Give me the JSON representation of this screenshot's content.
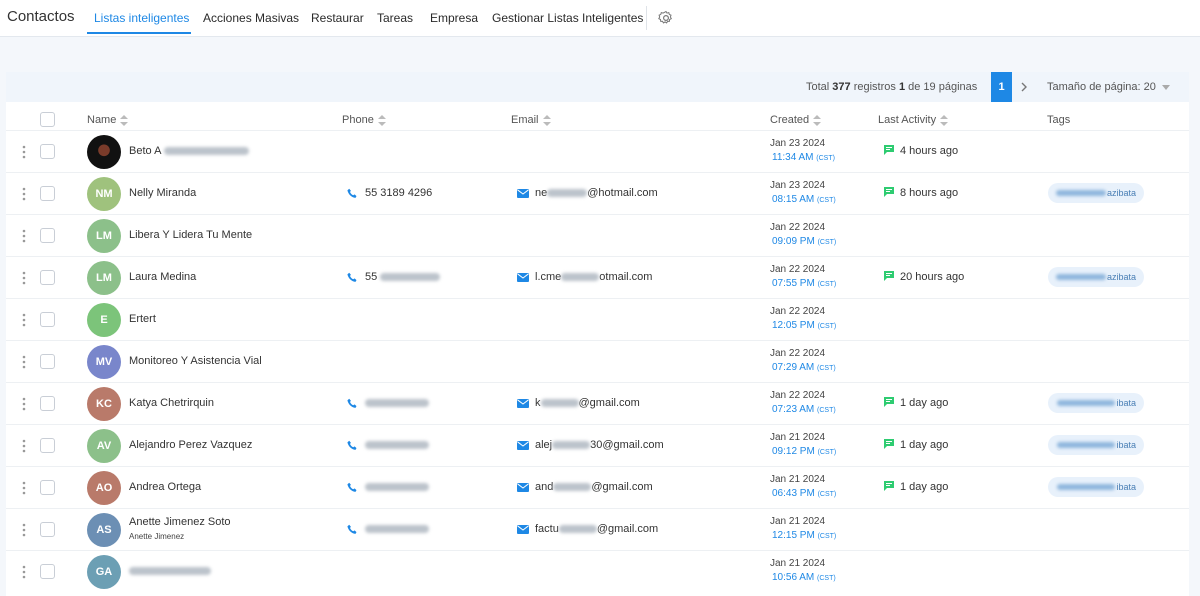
{
  "nav": {
    "brand": "Contactos",
    "tabs": [
      {
        "label": "Listas inteligentes"
      },
      {
        "label": "Acciones Masivas"
      },
      {
        "label": "Restaurar"
      },
      {
        "label": "Tareas"
      },
      {
        "label": "Empresa"
      },
      {
        "label": "Gestionar Listas Inteligentes"
      }
    ],
    "active_tab": "Listas inteligentes",
    "settings_icon": "gear-icon"
  },
  "pager": {
    "prefix": "Total ",
    "total": "377",
    "middle": " registros ",
    "current": "1",
    "suffix": " de 19 páginas",
    "page_button": "1",
    "page_size_label": "Tamaño de página: 20"
  },
  "table": {
    "headers": {
      "name": "Name",
      "phone": "Phone",
      "email": "Email",
      "created": "Created",
      "last_activity": "Last Activity",
      "tags": "Tags"
    },
    "rows": [
      {
        "initials": "",
        "name": "Beto A",
        "subname": "",
        "phone": "",
        "email": "",
        "created_date": "Jan 23 2024",
        "created_time": "11:34 AM",
        "tz": "(CST)",
        "activity": "4 hours ago",
        "tag": ""
      },
      {
        "initials": "NM",
        "name": "Nelly Miranda",
        "subname": "",
        "phone": "55 3189 4296",
        "email": "ne@hotmail.com",
        "created_date": "Jan 23 2024",
        "created_time": "08:15 AM",
        "tz": "(CST)",
        "activity": "8 hours ago",
        "tag": "azibata"
      },
      {
        "initials": "LM",
        "name": "Libera Y Lidera Tu Mente",
        "subname": "",
        "phone": "",
        "email": "",
        "created_date": "Jan 22 2024",
        "created_time": "09:09 PM",
        "tz": "(CST)",
        "activity": "",
        "tag": ""
      },
      {
        "initials": "LM",
        "name": "Laura Medina",
        "subname": "",
        "phone": "55",
        "email": "l.cme otmail.com",
        "created_date": "Jan 22 2024",
        "created_time": "07:55 PM",
        "tz": "(CST)",
        "activity": "20 hours ago",
        "tag": "azibata"
      },
      {
        "initials": "E",
        "name": "Ertert",
        "subname": "",
        "phone": "",
        "email": "",
        "created_date": "Jan 22 2024",
        "created_time": "12:05 PM",
        "tz": "(CST)",
        "activity": "",
        "tag": ""
      },
      {
        "initials": "MV",
        "name": "Monitoreo Y Asistencia Vial",
        "subname": "",
        "phone": "",
        "email": "",
        "created_date": "Jan 22 2024",
        "created_time": "07:29 AM",
        "tz": "(CST)",
        "activity": "",
        "tag": ""
      },
      {
        "initials": "KC",
        "name": "Katya Chetrirquin",
        "subname": "",
        "phone": "",
        "email": "k @gmail.com",
        "created_date": "Jan 22 2024",
        "created_time": "07:23 AM",
        "tz": "(CST)",
        "activity": "1 day ago",
        "tag": "ibata"
      },
      {
        "initials": "AV",
        "name": "Alejandro Perez Vazquez",
        "subname": "",
        "phone": "",
        "email": "alej 30@gmail.com",
        "created_date": "Jan 21 2024",
        "created_time": "09:12 PM",
        "tz": "(CST)",
        "activity": "1 day ago",
        "tag": "ibata"
      },
      {
        "initials": "AO",
        "name": "Andrea Ortega",
        "subname": "",
        "phone": "",
        "email": "and @gmail.com",
        "created_date": "Jan 21 2024",
        "created_time": "06:43 PM",
        "tz": "(CST)",
        "activity": "1 day ago",
        "tag": "ibata"
      },
      {
        "initials": "AS",
        "name": "Anette Jimenez Soto",
        "subname": "Anette Jimenez",
        "phone": "",
        "email": "factu @gmail.com",
        "created_date": "Jan 21 2024",
        "created_time": "12:15 PM",
        "tz": "(CST)",
        "activity": "",
        "tag": ""
      },
      {
        "initials": "GA",
        "name": "",
        "subname": "",
        "phone": "",
        "email": "",
        "created_date": "Jan 21 2024",
        "created_time": "10:56 AM",
        "tz": "(CST)",
        "activity": "",
        "tag": ""
      }
    ]
  },
  "colors": {
    "accent": "#1e88e5",
    "activity_icon": "#2ecc71",
    "avatar_green": "#8cc08a",
    "avatar_purple": "#7986cb",
    "avatar_brown": "#b97a6a",
    "avatar_blue": "#6c8fb4"
  }
}
